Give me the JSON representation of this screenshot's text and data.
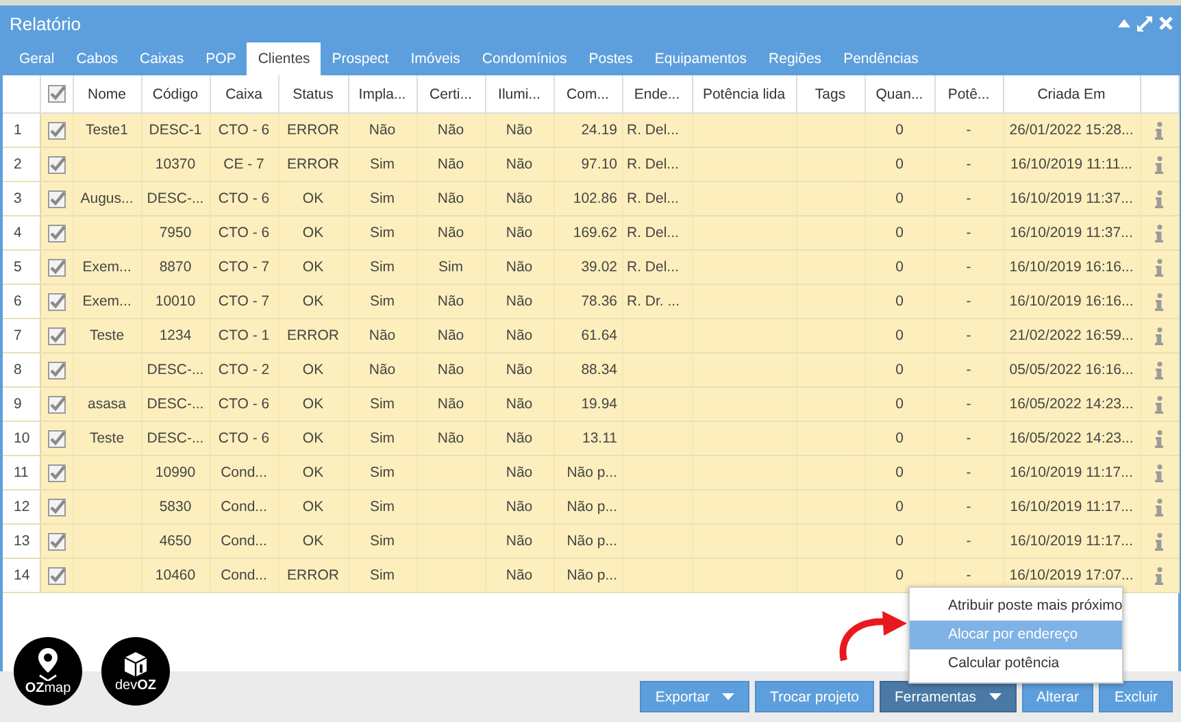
{
  "window": {
    "title": "Relatório"
  },
  "tabs": [
    {
      "label": "Geral",
      "selected": false
    },
    {
      "label": "Cabos",
      "selected": false
    },
    {
      "label": "Caixas",
      "selected": false
    },
    {
      "label": "POP",
      "selected": false
    },
    {
      "label": "Clientes",
      "selected": true
    },
    {
      "label": "Prospect",
      "selected": false
    },
    {
      "label": "Imóveis",
      "selected": false
    },
    {
      "label": "Condomínios",
      "selected": false
    },
    {
      "label": "Postes",
      "selected": false
    },
    {
      "label": "Equipamentos",
      "selected": false
    },
    {
      "label": "Regiões",
      "selected": false
    },
    {
      "label": "Pendências",
      "selected": false
    }
  ],
  "table": {
    "header_checked": true,
    "columns": [
      "Nome",
      "Código",
      "Caixa",
      "Status",
      "Impla...",
      "Certi...",
      "Ilumi...",
      "Com...",
      "Ende...",
      "Potência lida",
      "Tags",
      "Quan...",
      "Potê...",
      "Criada Em"
    ],
    "rows": [
      {
        "number": "1",
        "checked": true,
        "selected": true,
        "cells": [
          "Teste1",
          "DESC-1",
          "CTO - 6",
          "ERROR",
          "Não",
          "Não",
          "Não",
          "24.19",
          "R. Del...",
          null,
          null,
          "0",
          "-",
          "26/01/2022 15:28..."
        ]
      },
      {
        "number": "2",
        "checked": true,
        "selected": true,
        "cells": [
          null,
          "10370",
          "CE - 7",
          "ERROR",
          "Sim",
          "Não",
          "Não",
          "97.10",
          "R. Del...",
          null,
          null,
          "0",
          "-",
          "16/10/2019 11:11..."
        ]
      },
      {
        "number": "3",
        "checked": true,
        "selected": true,
        "cells": [
          "Augus...",
          "DESC-...",
          "CTO - 6",
          "OK",
          "Sim",
          "Não",
          "Não",
          "102.86",
          "R. Del...",
          null,
          null,
          "0",
          "-",
          "16/10/2019 11:37..."
        ]
      },
      {
        "number": "4",
        "checked": true,
        "selected": true,
        "cells": [
          null,
          "7950",
          "CTO - 6",
          "OK",
          "Sim",
          "Não",
          "Não",
          "169.62",
          "R. Del...",
          null,
          null,
          "0",
          "-",
          "16/10/2019 11:37..."
        ]
      },
      {
        "number": "5",
        "checked": true,
        "selected": true,
        "cells": [
          "Exem...",
          "8870",
          "CTO - 7",
          "OK",
          "Sim",
          "Sim",
          "Não",
          "39.02",
          "R. Del...",
          null,
          null,
          "0",
          "-",
          "16/10/2019 16:16..."
        ]
      },
      {
        "number": "6",
        "checked": true,
        "selected": true,
        "cells": [
          "Exem...",
          "10010",
          "CTO - 7",
          "OK",
          "Sim",
          "Não",
          "Não",
          "78.36",
          "R. Dr. ...",
          null,
          null,
          "0",
          "-",
          "16/10/2019 16:16..."
        ]
      },
      {
        "number": "7",
        "checked": true,
        "selected": true,
        "cells": [
          "Teste",
          "1234",
          "CTO - 1",
          "ERROR",
          "Não",
          "Não",
          "Não",
          "61.64",
          null,
          null,
          null,
          "0",
          "-",
          "21/02/2022 16:59..."
        ]
      },
      {
        "number": "8",
        "checked": true,
        "selected": true,
        "cells": [
          null,
          "DESC-...",
          "CTO - 2",
          "OK",
          "Não",
          "Não",
          "Não",
          "88.34",
          null,
          null,
          null,
          "0",
          "-",
          "05/05/2022 16:16..."
        ]
      },
      {
        "number": "9",
        "checked": true,
        "selected": true,
        "cells": [
          "asasa",
          "DESC-...",
          "CTO - 6",
          "OK",
          "Sim",
          "Não",
          "Não",
          "19.94",
          null,
          null,
          null,
          "0",
          "-",
          "16/05/2022 14:23..."
        ]
      },
      {
        "number": "10",
        "checked": true,
        "selected": true,
        "cells": [
          "Teste",
          "DESC-...",
          "CTO - 6",
          "OK",
          "Sim",
          "Não",
          "Não",
          "13.11",
          null,
          null,
          null,
          "0",
          "-",
          "16/05/2022 14:23..."
        ]
      },
      {
        "number": "11",
        "checked": true,
        "selected": true,
        "cells": [
          null,
          "10990",
          "Cond...",
          "OK",
          "Sim",
          null,
          "Não",
          "Não p...",
          null,
          null,
          null,
          "0",
          "-",
          "16/10/2019 11:17..."
        ]
      },
      {
        "number": "12",
        "checked": true,
        "selected": true,
        "cells": [
          null,
          "5830",
          "Cond...",
          "OK",
          "Sim",
          null,
          "Não",
          "Não p...",
          null,
          null,
          null,
          "0",
          "-",
          "16/10/2019 11:17..."
        ]
      },
      {
        "number": "13",
        "checked": true,
        "selected": true,
        "cells": [
          null,
          "4650",
          "Cond...",
          "OK",
          "Sim",
          null,
          "Não",
          "Não p...",
          null,
          null,
          null,
          "0",
          "-",
          "16/10/2019 11:17..."
        ]
      },
      {
        "number": "14",
        "checked": true,
        "selected": true,
        "cells": [
          null,
          "10460",
          "Cond...",
          "ERROR",
          "Sim",
          null,
          "Não",
          "Não p...",
          null,
          null,
          null,
          "0",
          "-",
          "16/10/2019 17:07..."
        ]
      }
    ]
  },
  "menu": {
    "items": [
      {
        "label": "Atribuir poste mais próximo",
        "selected": false
      },
      {
        "label": "Alocar por endereço",
        "selected": true
      },
      {
        "label": "Calcular potência",
        "selected": false
      }
    ]
  },
  "logos": [
    {
      "kind": "pin",
      "label": "**OZ**map"
    },
    {
      "kind": "cube",
      "label": "dev**OZ**"
    }
  ],
  "buttons": [
    {
      "label": "Exportar",
      "dropdown": true,
      "active": false
    },
    {
      "label": "Trocar projeto",
      "dropdown": false,
      "active": false
    },
    {
      "label": "Ferramentas",
      "dropdown": true,
      "active": true
    },
    {
      "label": "Alterar",
      "dropdown": false,
      "active": false
    },
    {
      "label": "Excluir",
      "dropdown": false,
      "active": false
    }
  ]
}
